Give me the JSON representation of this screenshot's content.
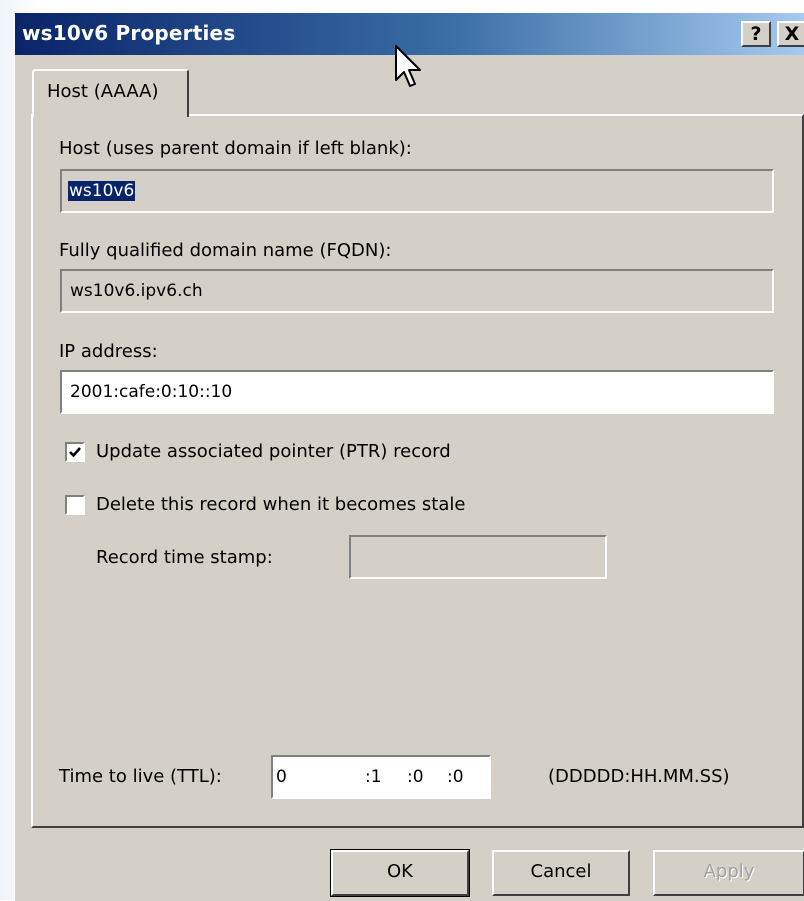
{
  "window": {
    "title": "ws10v6 Properties",
    "help_label": "?",
    "close_label": "X"
  },
  "tabs": [
    {
      "label": "Host (AAAA)",
      "selected": true
    }
  ],
  "host": {
    "label": "Host (uses parent domain if left blank):",
    "value": "ws10v6"
  },
  "fqdn": {
    "label": "Fully qualified domain name (FQDN):",
    "value": "ws10v6.ipv6.ch"
  },
  "ip": {
    "label": "IP address:",
    "value": "2001:cafe:0:10::10"
  },
  "checkboxes": {
    "ptr": {
      "label": "Update associated pointer (PTR) record",
      "checked": true
    },
    "stale": {
      "label": "Delete this record when it becomes stale",
      "checked": false
    }
  },
  "timestamp": {
    "label": "Record time stamp:",
    "value": ""
  },
  "ttl": {
    "label": "Time to live (TTL):",
    "days": "0",
    "hours": ":1",
    "minutes": ":0",
    "seconds": ":0",
    "format": "(DDDDD:HH.MM.SS)"
  },
  "buttons": {
    "ok": "OK",
    "cancel": "Cancel",
    "apply": "Apply"
  },
  "colors": {
    "dialog_bg": "#d4d0c8",
    "titlebar_start": "#0a246a",
    "titlebar_end": "#a6caf0",
    "selection": "#0a246a"
  }
}
